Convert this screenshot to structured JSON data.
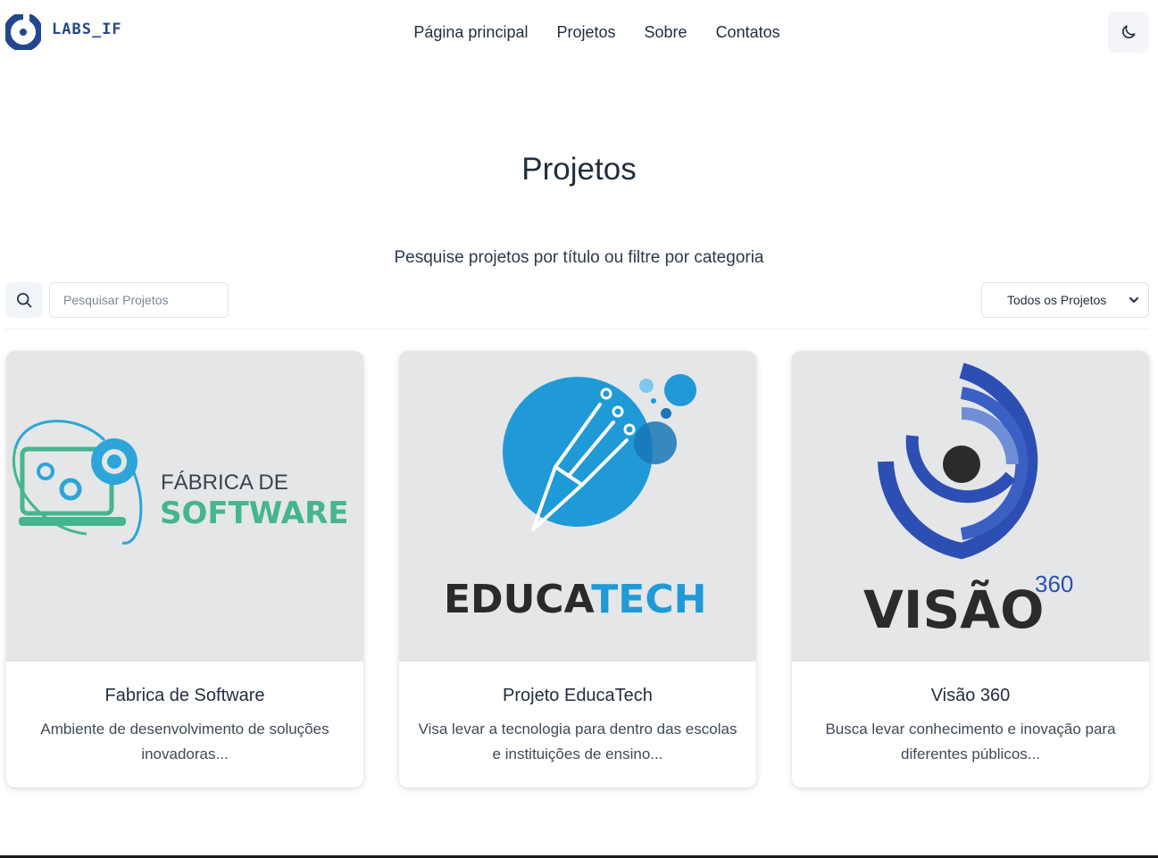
{
  "brand": {
    "name": "LABS_IF",
    "logo_color": "#23478f"
  },
  "nav": {
    "items": [
      {
        "label": "Página principal"
      },
      {
        "label": "Projetos"
      },
      {
        "label": "Sobre"
      },
      {
        "label": "Contatos"
      }
    ]
  },
  "theme_toggle": {
    "icon": "moon-icon"
  },
  "page": {
    "title": "Projetos",
    "subtitle": "Pesquise projetos por título ou filtre por categoria"
  },
  "search": {
    "icon": "search-icon",
    "placeholder": "Pesquisar Projetos",
    "value": ""
  },
  "filter": {
    "selected": "Todos os Projetos"
  },
  "projects": [
    {
      "title": "Fabrica de Software",
      "description": "Ambiente de desenvolvimento de soluções inovadoras...",
      "logo": {
        "line1": "FÁBRICA DE",
        "line2": "SOFTWARE"
      }
    },
    {
      "title": "Projeto EducaTech",
      "description": "Visa levar a tecnologia para dentro das escolas e instituições de ensino...",
      "logo": {
        "part1": "EDUCA",
        "part2": "TECH"
      }
    },
    {
      "title": "Visão 360",
      "description": "Busca levar conhecimento e inovação para diferentes públicos...",
      "logo": {
        "word": "VISÃO",
        "sup": "360"
      }
    }
  ],
  "colors": {
    "text_dark": "#1f2d3d",
    "card_image_bg": "#e5e6e8",
    "educatech_blue": "#1f9ad6",
    "software_green": "#45b58f",
    "visao_blue": "#2d4fb3"
  }
}
